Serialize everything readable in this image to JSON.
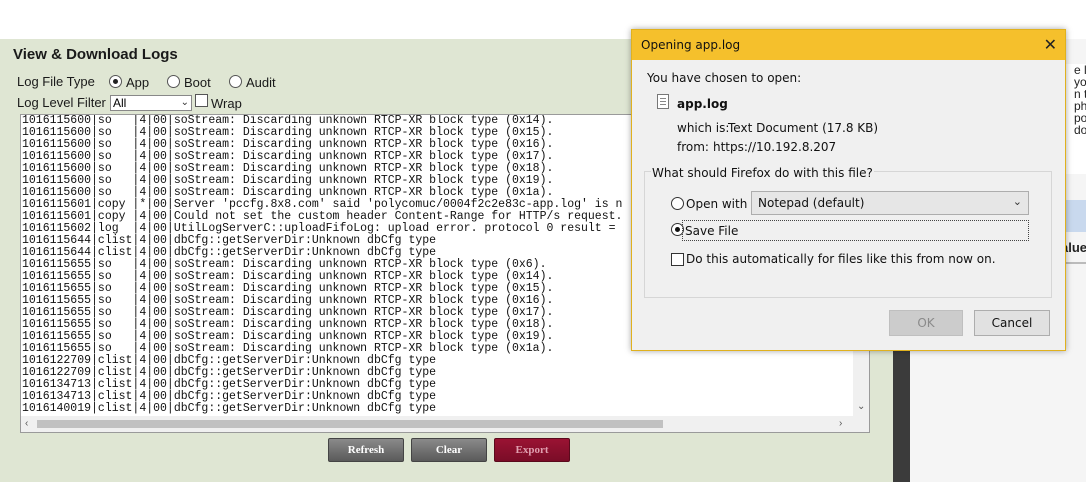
{
  "panel": {
    "title": "View & Download Logs",
    "log_file_type_label": "Log File Type",
    "file_types": [
      "App",
      "Boot",
      "Audit"
    ],
    "selected_file_type": "App",
    "log_level_label": "Log Level Filter",
    "log_level_value": "All",
    "wrap_label": "Wrap",
    "wrap_checked": false,
    "log_lines": [
      "1016115600|so   |4|00|soStream: Discarding unknown RTCP-XR block type (0x14).",
      "1016115600|so   |4|00|soStream: Discarding unknown RTCP-XR block type (0x15).",
      "1016115600|so   |4|00|soStream: Discarding unknown RTCP-XR block type (0x16).",
      "1016115600|so   |4|00|soStream: Discarding unknown RTCP-XR block type (0x17).",
      "1016115600|so   |4|00|soStream: Discarding unknown RTCP-XR block type (0x18).",
      "1016115600|so   |4|00|soStream: Discarding unknown RTCP-XR block type (0x19).",
      "1016115600|so   |4|00|soStream: Discarding unknown RTCP-XR block type (0x1a).",
      "1016115601|copy |*|00|Server 'pccfg.8x8.com' said 'polycomuc/0004f2c2e83c-app.log' is n",
      "1016115601|copy |4|00|Could not set the custom header Content-Range for HTTP/s request.",
      "1016115602|log  |4|00|UtilLogServerC::uploadFifoLog: upload error. protocol 0 result =",
      "1016115644|clist|4|00|dbCfg::getServerDir:Unknown dbCfg type",
      "1016115644|clist|4|00|dbCfg::getServerDir:Unknown dbCfg type",
      "1016115655|so   |4|00|soStream: Discarding unknown RTCP-XR block type (0x6).",
      "1016115655|so   |4|00|soStream: Discarding unknown RTCP-XR block type (0x14).",
      "1016115655|so   |4|00|soStream: Discarding unknown RTCP-XR block type (0x15).",
      "1016115655|so   |4|00|soStream: Discarding unknown RTCP-XR block type (0x16).",
      "1016115655|so   |4|00|soStream: Discarding unknown RTCP-XR block type (0x17).",
      "1016115655|so   |4|00|soStream: Discarding unknown RTCP-XR block type (0x18).",
      "1016115655|so   |4|00|soStream: Discarding unknown RTCP-XR block type (0x19).",
      "1016115655|so   |4|00|soStream: Discarding unknown RTCP-XR block type (0x1a).",
      "1016122709|clist|4|00|dbCfg::getServerDir:Unknown dbCfg type",
      "1016122709|clist|4|00|dbCfg::getServerDir:Unknown dbCfg type",
      "1016134713|clist|4|00|dbCfg::getServerDir:Unknown dbCfg type",
      "1016134713|clist|4|00|dbCfg::getServerDir:Unknown dbCfg type",
      "1016140019|clist|4|00|dbCfg::getServerDir:Unknown dbCfg type"
    ],
    "buttons": {
      "refresh": "Refresh",
      "clear": "Clear",
      "export": "Export"
    },
    "colors": {
      "panel_bg": "#dfe6d3",
      "export_bg": "#8a1030",
      "button_gray": "#6e6e6e"
    }
  },
  "right_partial": {
    "lines": [
      "e log",
      "you",
      "n to",
      "pho",
      "port",
      "dow"
    ],
    "value_label": "alue"
  },
  "dialog": {
    "title": "Opening app.log",
    "chosen_text": "You have chosen to open:",
    "file_name": "app.log",
    "which_is_label": "which is:",
    "which_is_value": "Text Document (17.8 KB)",
    "from_label": "from:",
    "from_value": "https://10.192.8.207",
    "question": "What should Firefox do with this file?",
    "open_with_label": "Open with",
    "open_with_app": "Notepad (default)",
    "save_file_label": "Save File",
    "selected_action": "save",
    "auto_label": "Do this automatically for files like this from now on.",
    "auto_checked": false,
    "ok_label": "OK",
    "cancel_label": "Cancel",
    "colors": {
      "titlebar": "#f5c02c"
    }
  }
}
